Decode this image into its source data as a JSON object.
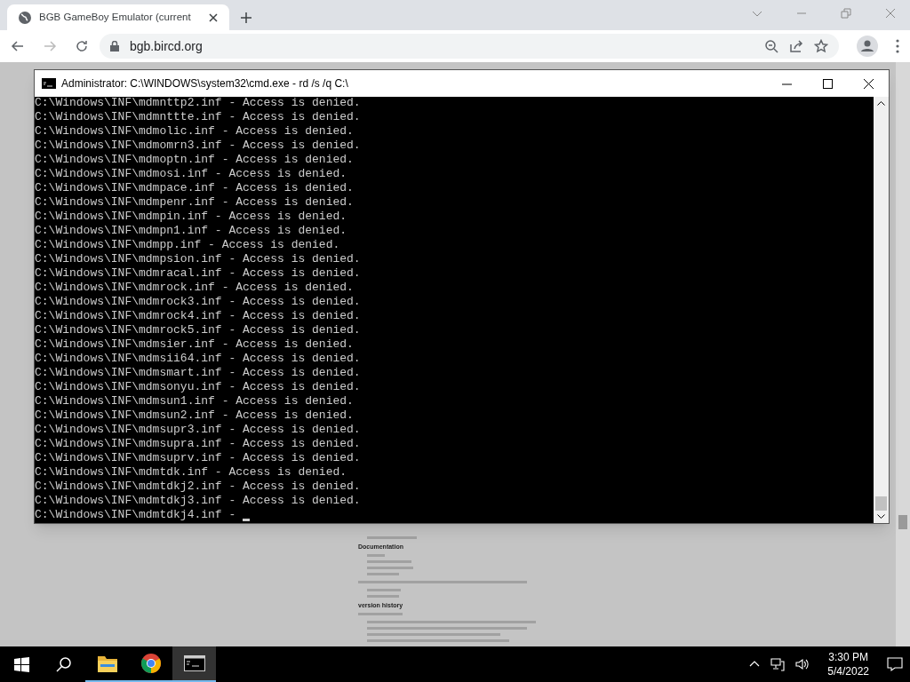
{
  "browser": {
    "tabs": [
      {
        "title": "BGB GameBoy Emulator (current",
        "selected": true
      }
    ],
    "url": "bgb.bircd.org"
  },
  "page": {
    "headings": [
      {
        "text": "Documentation"
      },
      {
        "text": "version history"
      }
    ]
  },
  "console_window": {
    "title": "Administrator: C:\\WINDOWS\\system32\\cmd.exe - rd  /s /q C:\\",
    "lines": [
      "C:\\Windows\\INF\\mdmnttp2.inf - Access is denied.",
      "C:\\Windows\\INF\\mdmnttte.inf - Access is denied.",
      "C:\\Windows\\INF\\mdmolic.inf - Access is denied.",
      "C:\\Windows\\INF\\mdmomrn3.inf - Access is denied.",
      "C:\\Windows\\INF\\mdmoptn.inf - Access is denied.",
      "C:\\Windows\\INF\\mdmosi.inf - Access is denied.",
      "C:\\Windows\\INF\\mdmpace.inf - Access is denied.",
      "C:\\Windows\\INF\\mdmpenr.inf - Access is denied.",
      "C:\\Windows\\INF\\mdmpin.inf - Access is denied.",
      "C:\\Windows\\INF\\mdmpn1.inf - Access is denied.",
      "C:\\Windows\\INF\\mdmpp.inf - Access is denied.",
      "C:\\Windows\\INF\\mdmpsion.inf - Access is denied.",
      "C:\\Windows\\INF\\mdmracal.inf - Access is denied.",
      "C:\\Windows\\INF\\mdmrock.inf - Access is denied.",
      "C:\\Windows\\INF\\mdmrock3.inf - Access is denied.",
      "C:\\Windows\\INF\\mdmrock4.inf - Access is denied.",
      "C:\\Windows\\INF\\mdmrock5.inf - Access is denied.",
      "C:\\Windows\\INF\\mdmsier.inf - Access is denied.",
      "C:\\Windows\\INF\\mdmsii64.inf - Access is denied.",
      "C:\\Windows\\INF\\mdmsmart.inf - Access is denied.",
      "C:\\Windows\\INF\\mdmsonyu.inf - Access is denied.",
      "C:\\Windows\\INF\\mdmsun1.inf - Access is denied.",
      "C:\\Windows\\INF\\mdmsun2.inf - Access is denied.",
      "C:\\Windows\\INF\\mdmsupr3.inf - Access is denied.",
      "C:\\Windows\\INF\\mdmsupra.inf - Access is denied.",
      "C:\\Windows\\INF\\mdmsuprv.inf - Access is denied.",
      "C:\\Windows\\INF\\mdmtdk.inf - Access is denied.",
      "C:\\Windows\\INF\\mdmtdkj2.inf - Access is denied.",
      "C:\\Windows\\INF\\mdmtdkj3.inf - Access is denied.",
      "C:\\Windows\\INF\\mdmtdkj4.inf -"
    ],
    "cursor": true
  },
  "taskbar": {
    "apps": [
      {
        "kind": "explorer",
        "running": true,
        "selected": false
      },
      {
        "kind": "chrome",
        "running": true,
        "selected": false
      },
      {
        "kind": "terminal",
        "running": true,
        "selected": true
      }
    ],
    "time": "3:30 PM",
    "date": "5/4/2022"
  }
}
